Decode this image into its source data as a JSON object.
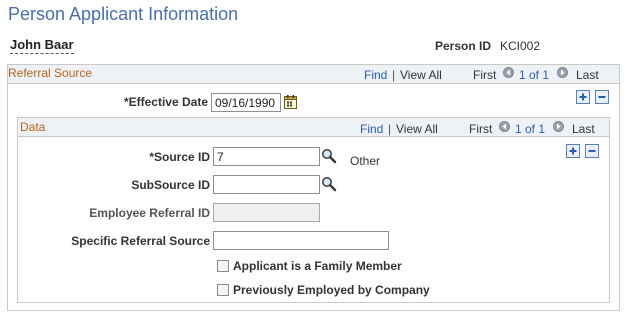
{
  "page": {
    "title": "Person Applicant Information",
    "person_name": "John Baar",
    "person_id_label": "Person ID",
    "person_id_value": "KCI002"
  },
  "referral_source": {
    "title": "Referral Source",
    "find": "Find",
    "sep": "|",
    "view_all": "View All",
    "first": "First",
    "counter": "1 of 1",
    "last": "Last",
    "effective_date_label": "*Effective Date",
    "effective_date_value": "09/16/1990"
  },
  "data_section": {
    "title": "Data",
    "find": "Find",
    "sep": "|",
    "view_all": "View All",
    "first": "First",
    "counter": "1 of 1",
    "last": "Last",
    "source_id_label": "*Source ID",
    "source_id_value": "7",
    "source_id_desc": "Other",
    "subsource_id_label": "SubSource ID",
    "subsource_id_value": "",
    "employee_referral_id_label": "Employee Referral ID",
    "specific_referral_label": "Specific Referral Source",
    "specific_referral_value": "",
    "family_member_label": "Applicant is a Family Member",
    "previously_employed_label": "Previously Employed by Company"
  },
  "colors": {
    "title_blue": "#4a6ea9",
    "section_title": "#b5651d",
    "link": "#2a5db0",
    "header_bg": "#eef1f6"
  }
}
